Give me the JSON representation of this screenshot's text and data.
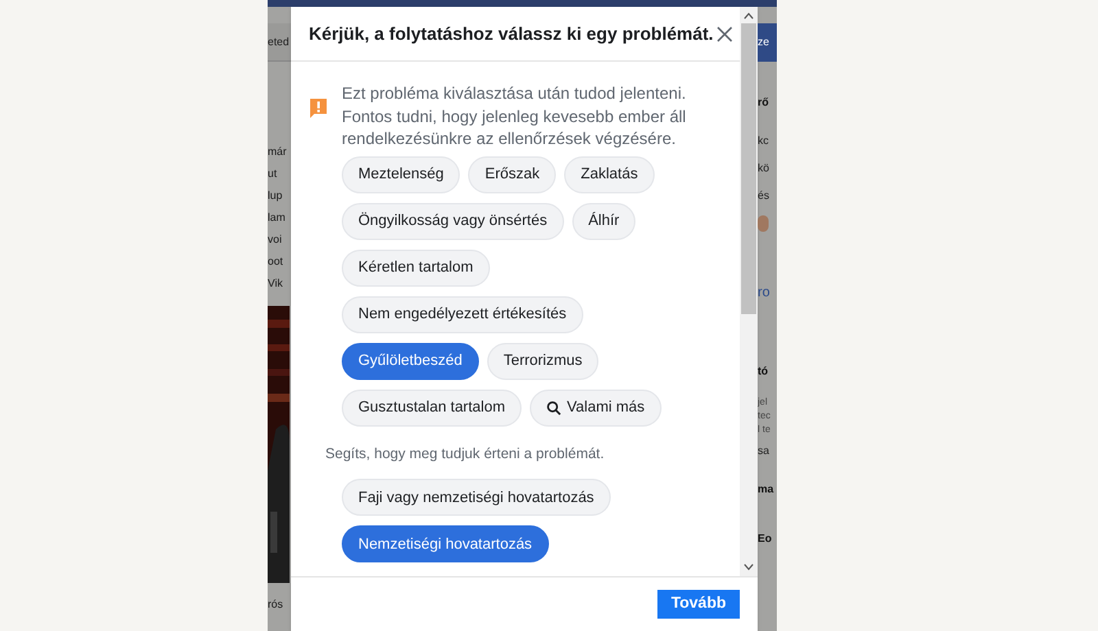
{
  "background": {
    "left_fragments": [
      {
        "text": "eted",
        "kind": "bar"
      },
      {
        "text": "már",
        "kind": "line"
      },
      {
        "text": "ut",
        "kind": "line"
      },
      {
        "text": "lup",
        "kind": "line"
      },
      {
        "text": "lam",
        "kind": "line"
      },
      {
        "text": "voi",
        "kind": "line"
      },
      {
        "text": "oot",
        "kind": "line"
      },
      {
        "text": "Vik",
        "kind": "line"
      },
      {
        "kind": "picture"
      },
      {
        "text": "rós",
        "kind": "line"
      }
    ],
    "right_fragments": [
      {
        "text": "ze",
        "kind": "button"
      },
      {
        "text": "rő",
        "kind": "heading"
      },
      {
        "text": "kc",
        "kind": "line"
      },
      {
        "text": "kö",
        "kind": "line"
      },
      {
        "text": "és",
        "kind": "line"
      },
      {
        "kind": "avatar"
      },
      {
        "text": "ro",
        "kind": "link"
      },
      {
        "text": "tó",
        "kind": "heading"
      },
      {
        "text": "jel",
        "kind": "small"
      },
      {
        "text": "tec",
        "kind": "small"
      },
      {
        "text": "l te",
        "kind": "small"
      },
      {
        "text": "sa",
        "kind": "line"
      },
      {
        "text": "ma",
        "kind": "heading"
      },
      {
        "text": "Eo",
        "kind": "heading"
      }
    ]
  },
  "dialog": {
    "title": "Kérjük, a folytatáshoz válassz ki egy problémát.",
    "notice": "Ezt probléma kiválasztása után tudod jelenteni. Fontos tudni, hogy jelenleg kevesebb ember áll rendelkezésünkre az ellenőrzések végzésére.",
    "problems": [
      [
        {
          "label": "Meztelenség",
          "selected": false,
          "kind": "plain"
        },
        {
          "label": "Erőszak",
          "selected": false,
          "kind": "plain"
        },
        {
          "label": "Zaklatás",
          "selected": false,
          "kind": "plain"
        }
      ],
      [
        {
          "label": "Öngyilkosság vagy önsértés",
          "selected": false,
          "kind": "plain"
        },
        {
          "label": "Álhír",
          "selected": false,
          "kind": "plain"
        }
      ],
      [
        {
          "label": "Kéretlen tartalom",
          "selected": false,
          "kind": "plain"
        }
      ],
      [
        {
          "label": "Nem engedélyezett értékesítés",
          "selected": false,
          "kind": "plain"
        }
      ],
      [
        {
          "label": "Gyűlöletbeszéd",
          "selected": true,
          "kind": "plain"
        },
        {
          "label": "Terrorizmus",
          "selected": false,
          "kind": "plain"
        }
      ],
      [
        {
          "label": "Gusztustalan tartalom",
          "selected": false,
          "kind": "plain"
        },
        {
          "label": "Valami más",
          "selected": false,
          "kind": "search"
        }
      ]
    ],
    "followup_prompt": "Segíts, hogy meg tudjuk érteni a problémát.",
    "details": [
      [
        {
          "label": "Faji vagy nemzetiségi hovatartozás",
          "selected": false
        }
      ],
      [
        {
          "label": "Nemzetiségi hovatartozás",
          "selected": true
        }
      ]
    ],
    "next_button": "Tovább"
  }
}
